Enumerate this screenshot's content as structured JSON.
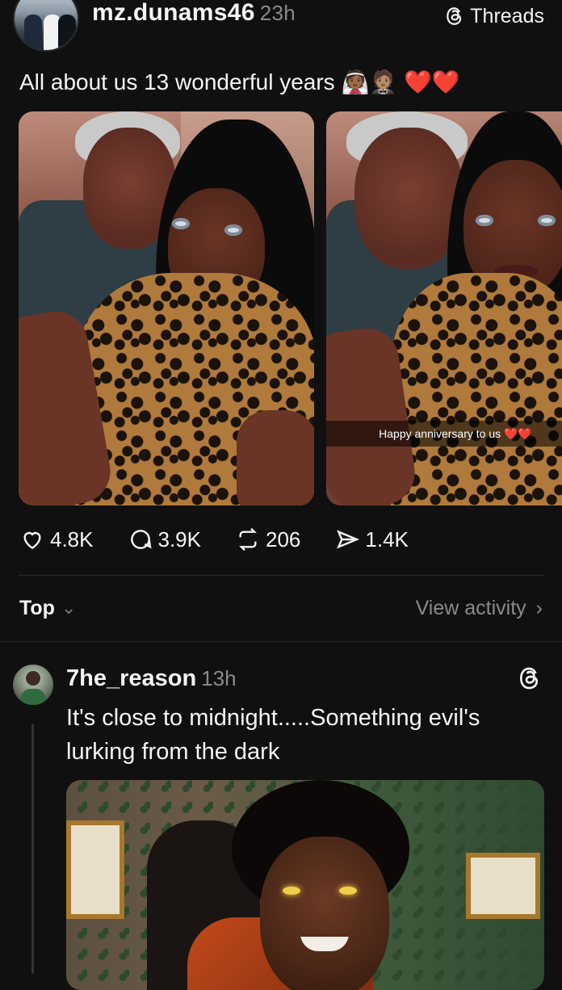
{
  "post1": {
    "username": "mz.dunams46",
    "time": "23h",
    "source_label": "Threads",
    "caption_text": "All about us 13 wonderful years",
    "caption_emojis": "👰🏾🤵🏽",
    "caption_hearts": "❤️❤️",
    "images": [
      {
        "name": "couple-selfie-1"
      },
      {
        "name": "couple-selfie-2",
        "overlay_text": "Happy anniversary to us ❤️❤️"
      }
    ],
    "stats": {
      "likes": "4.8K",
      "replies": "3.9K",
      "reposts": "206",
      "shares": "1.4K"
    }
  },
  "sort": {
    "label": "Top",
    "view_activity": "View activity"
  },
  "post2": {
    "username": "7he_reason",
    "time": "13h",
    "caption": "It's close to midnight.....Something evil's lurking from the dark"
  },
  "colors": {
    "background": "#101010",
    "text": "#f3f5f7",
    "muted": "#8a8a8a",
    "heart": "#ff2a3d"
  }
}
